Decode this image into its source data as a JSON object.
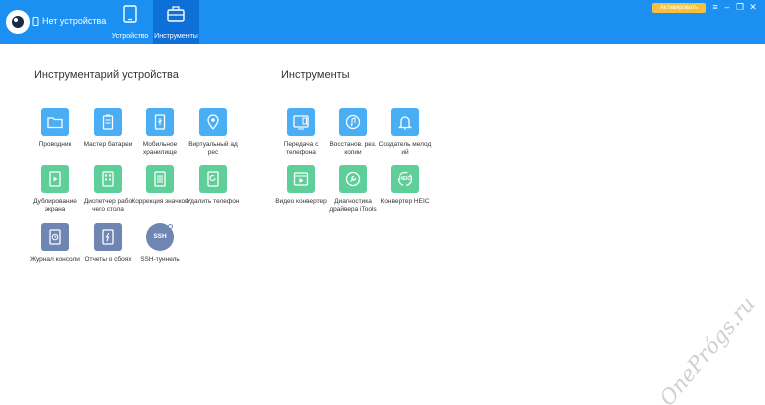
{
  "header": {
    "device_status": "Нет устройства",
    "tabs": [
      {
        "label": "Устройство",
        "icon": "tablet-icon"
      },
      {
        "label": "Инструменты",
        "icon": "toolbox-icon"
      }
    ],
    "activate_label": "Активировать"
  },
  "device_tools": {
    "title": "Инструментарий устройства",
    "items": [
      {
        "label": "Проводник",
        "color": "#4aaef5"
      },
      {
        "label": "Мастер батареи",
        "color": "#4aaef5"
      },
      {
        "label": "Мобильное хранилище",
        "color": "#4aaef5"
      },
      {
        "label": "Виртуальный ад рес",
        "color": "#4aaef5"
      },
      {
        "label": "Дублирование экрана",
        "color": "#5fcf9a"
      },
      {
        "label": "Диспетчер рабо чего стола",
        "color": "#5fcf9a"
      },
      {
        "label": "Коррекция значков",
        "color": "#5fcf9a"
      },
      {
        "label": "Удалить телефон",
        "color": "#5fcf9a"
      },
      {
        "label": "Журнал консоли",
        "color": "#6f86b3"
      },
      {
        "label": "Отчеты о сбоях",
        "color": "#6f86b3"
      },
      {
        "label": "SSH-туннель",
        "color": "#6f86b3"
      }
    ]
  },
  "tools": {
    "title": "Инструменты",
    "items": [
      {
        "label": "Передача с телефона",
        "color": "#4aaef5"
      },
      {
        "label": "Восстанов. рез. копии",
        "color": "#4aaef5"
      },
      {
        "label": "Создатель мелод ий",
        "color": "#4aaef5"
      },
      {
        "label": "Видео конвертер",
        "color": "#5fcf9a"
      },
      {
        "label": "Диагностика драйвера iTools",
        "color": "#5fcf9a"
      },
      {
        "label": "Конвертер HEIC",
        "color": "#5fcf9a"
      }
    ]
  },
  "ssh_badge": "SSH",
  "heic_badge": "HEIC",
  "watermark": "OnePrógs.ru"
}
